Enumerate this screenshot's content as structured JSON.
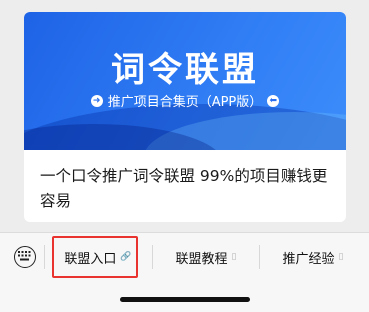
{
  "card": {
    "banner_title": "词令联盟",
    "banner_subtitle": "推广项目合集页（APP版）",
    "caption": "一个口令推广词令联盟 99%的项目赚钱更容易"
  },
  "menu": {
    "keyboard_icon": "keyboard-icon",
    "items": [
      {
        "label": "联盟入口",
        "icon": "link-icon"
      },
      {
        "label": "联盟教程",
        "icon": "article-icon"
      },
      {
        "label": "推广经验",
        "icon": "article-icon"
      }
    ]
  },
  "colors": {
    "banner_blue": "#2f7cf4",
    "highlight_red": "#e8332f",
    "menubar_bg": "#f7f7f7"
  }
}
